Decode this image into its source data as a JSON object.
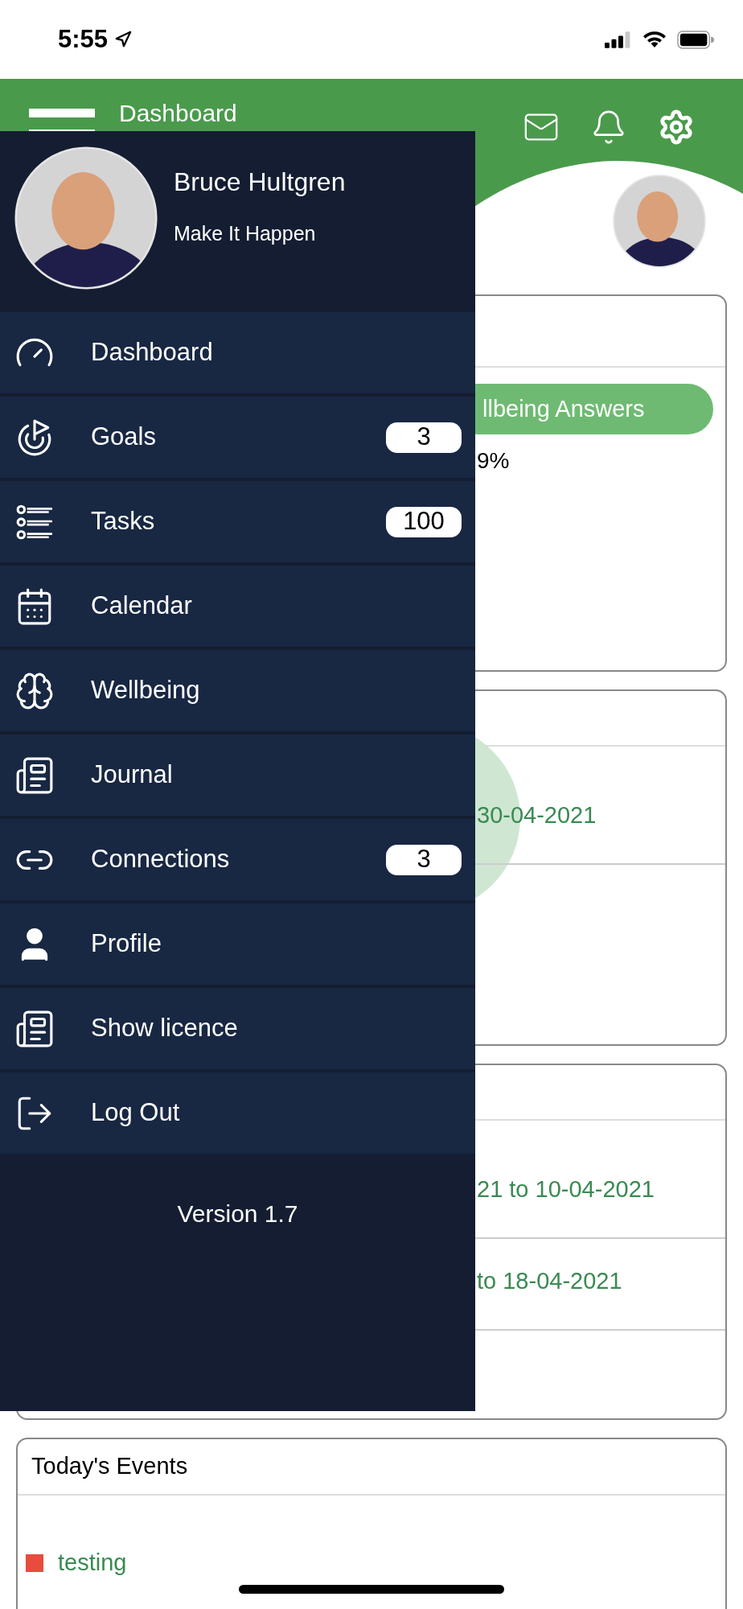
{
  "status_bar": {
    "time": "5:55"
  },
  "header": {
    "title": "Dashboard"
  },
  "drawer": {
    "user_name": "Bruce Hultgren",
    "tagline": "Make It Happen",
    "items": [
      {
        "label": "Dashboard"
      },
      {
        "label": "Goals",
        "badge": "3"
      },
      {
        "label": "Tasks",
        "badge": "100"
      },
      {
        "label": "Calendar"
      },
      {
        "label": "Wellbeing"
      },
      {
        "label": "Journal"
      },
      {
        "label": "Connections",
        "badge": "3"
      },
      {
        "label": "Profile"
      },
      {
        "label": "Show licence"
      },
      {
        "label": "Log Out"
      }
    ],
    "version": "Version 1.7"
  },
  "wellbeing_card": {
    "button": "llbeing Answers",
    "value": "9%"
  },
  "progress_card": {
    "date": "30-04-2021"
  },
  "periods_card": {
    "rows": [
      "21 to 10-04-2021",
      "to 18-04-2021"
    ]
  },
  "events_card": {
    "title": "Today's Events",
    "events": [
      {
        "name": "testing",
        "color": "#e74c3c"
      }
    ]
  }
}
